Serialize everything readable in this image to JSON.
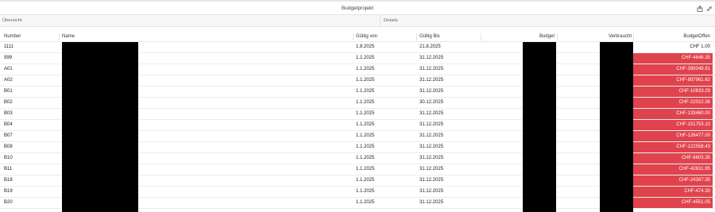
{
  "window": {
    "title": "Budgetprojekt"
  },
  "tabs": [
    {
      "label": "Übersicht"
    },
    {
      "label": "Details"
    }
  ],
  "table": {
    "headers": {
      "number": "Number",
      "name": "Name",
      "gueltig_von": "Gültig von",
      "gueltig_bis": "Gültig Bis",
      "budget": "Budget",
      "verbraucht": "Verbraucht",
      "budget_offen": "BudgetOffen"
    },
    "rows": [
      {
        "number": "1111",
        "von": "1.8.2025",
        "bis": "21.8.2025",
        "offen": "CHF 1.00",
        "negative": false
      },
      {
        "number": "999",
        "von": "1.1.2025",
        "bis": "31.12.2025",
        "offen": "CHF-4646.35",
        "negative": true
      },
      {
        "number": "A01",
        "von": "1.1.2025",
        "bis": "31.12.2025",
        "offen": "CHF-395049.91",
        "negative": true
      },
      {
        "number": "A02",
        "von": "1.1.2025",
        "bis": "31.12.2025",
        "offen": "CHF-897961.62",
        "negative": true
      },
      {
        "number": "B01",
        "von": "1.1.2025",
        "bis": "31.12.2025",
        "offen": "CHF-10633.29",
        "negative": true
      },
      {
        "number": "B02",
        "von": "1.1.2025",
        "bis": "30.12.2025",
        "offen": "CHF-22022.36",
        "negative": true
      },
      {
        "number": "B03",
        "von": "1.1.2025",
        "bis": "31.12.2025",
        "offen": "CHF-133460.00",
        "negative": true
      },
      {
        "number": "B04",
        "von": "1.1.2025",
        "bis": "31.12.2025",
        "offen": "CHF-151753.10",
        "negative": true
      },
      {
        "number": "B07",
        "von": "1.1.2025",
        "bis": "31.12.2025",
        "offen": "CHF-126477.00",
        "negative": true
      },
      {
        "number": "B08",
        "von": "1.1.2025",
        "bis": "31.12.2025",
        "offen": "CHF-122558.43",
        "negative": true
      },
      {
        "number": "B10",
        "von": "1.1.2025",
        "bis": "31.12.2025",
        "offen": "CHF-6603.35",
        "negative": true
      },
      {
        "number": "B11",
        "von": "1.1.2025",
        "bis": "31.12.2025",
        "offen": "CHF-42631.95",
        "negative": true
      },
      {
        "number": "B18",
        "von": "1.1.2025",
        "bis": "31.12.2025",
        "offen": "CHF-24387.35",
        "negative": true
      },
      {
        "number": "B19",
        "von": "1.1.2025",
        "bis": "31.12.2025",
        "offen": "CHF-474.30",
        "negative": true
      },
      {
        "number": "B20",
        "von": "1.1.2025",
        "bis": "31.12.2025",
        "offen": "CHF-4551.05",
        "negative": true
      }
    ]
  },
  "icons": {
    "share": "share-icon",
    "collapse": "collapse-icon"
  },
  "colors": {
    "negative_bg": "#e0434d",
    "redaction": "#000000"
  }
}
